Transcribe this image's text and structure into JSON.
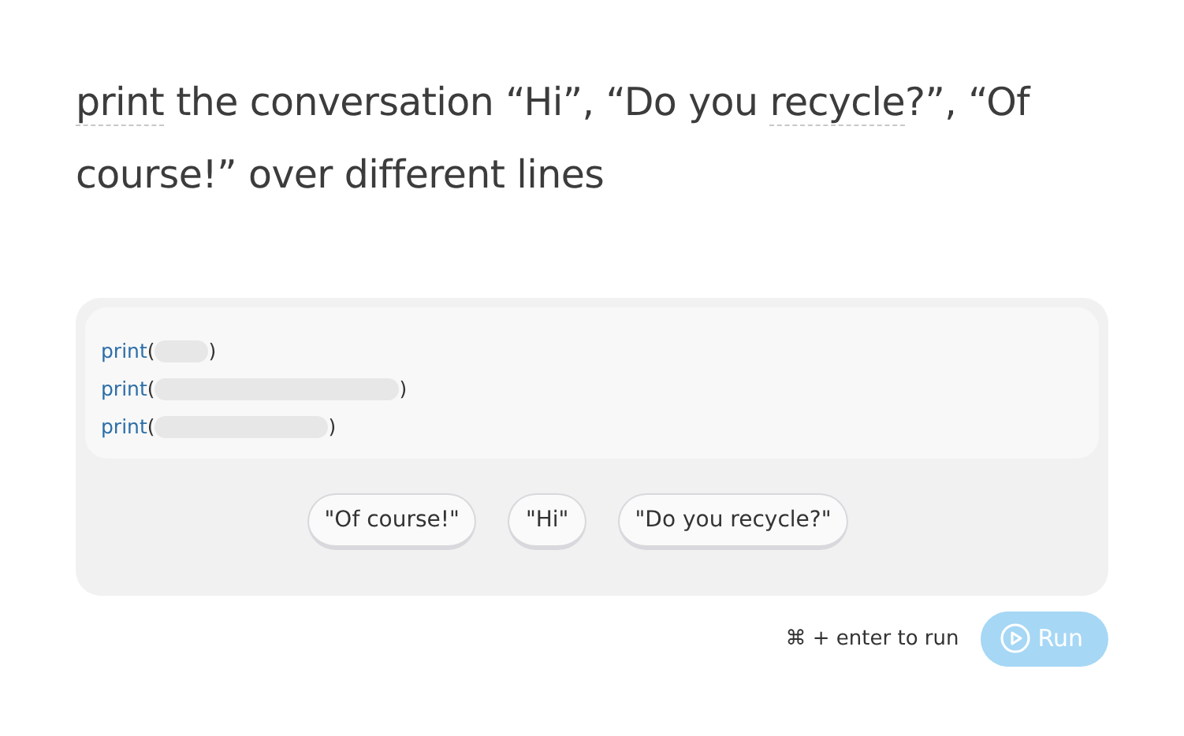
{
  "prompt": [
    {
      "text": "print",
      "term": true
    },
    {
      "text": " the conversation “Hi”, “Do you ",
      "term": false
    },
    {
      "text": "recycle",
      "term": true
    },
    {
      "text": "?”, “Of course!” over different lines",
      "term": false
    }
  ],
  "code_lines": [
    {
      "func": "print",
      "open": "(",
      "close": ")",
      "kind": "short"
    },
    {
      "func": "print",
      "open": "(",
      "close": ")",
      "kind": "long"
    },
    {
      "func": "print",
      "open": "(",
      "close": ")",
      "kind": "medium"
    }
  ],
  "options": [
    "\"Of course!\"",
    "\"Hi\"",
    "\"Do you recycle?\""
  ],
  "hint": "⌘ + enter to run",
  "run_button": {
    "label": "Run",
    "disabled": true
  }
}
